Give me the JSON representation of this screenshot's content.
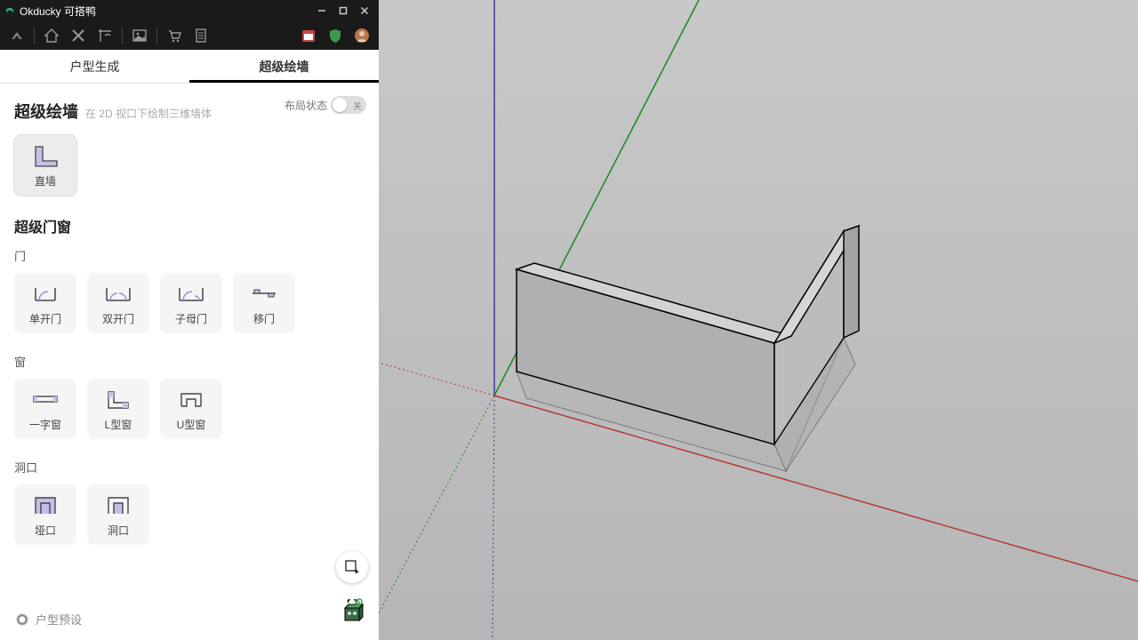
{
  "app": {
    "title": "Okducky 可搭鸭"
  },
  "tabs": {
    "a": "户型生成",
    "b": "超级绘墙"
  },
  "section1": {
    "title": "超级绘墙",
    "sub": "在 2D 视口下绘制三维墙体",
    "toggle_label": "布局状态",
    "toggle_state": "关"
  },
  "wall_card": "直墙",
  "section2": {
    "title": "超级门窗"
  },
  "doors_label": "门",
  "doors": {
    "d1": "单开门",
    "d2": "双开门",
    "d3": "子母门",
    "d4": "移门"
  },
  "windows_label": "窗",
  "windows": {
    "w1": "一字窗",
    "w2": "L型窗",
    "w3": "U型窗"
  },
  "openings_label": "洞口",
  "openings": {
    "o1": "垭口",
    "o2": "洞口"
  },
  "footer": {
    "preset": "户型预设"
  }
}
